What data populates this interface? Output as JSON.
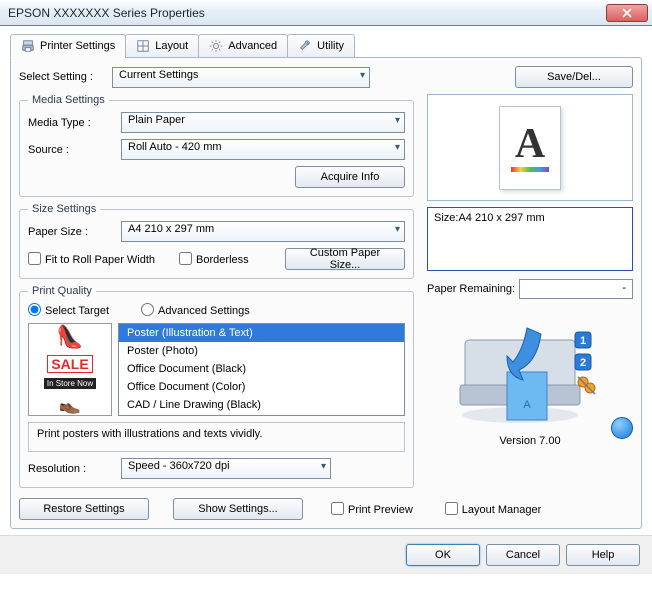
{
  "window": {
    "title": "EPSON XXXXXXX Series Properties"
  },
  "tabs": {
    "printer_settings": "Printer Settings",
    "layout": "Layout",
    "advanced": "Advanced",
    "utility": "Utility"
  },
  "select_setting": {
    "label": "Select Setting :",
    "value": "Current Settings",
    "save_del": "Save/Del..."
  },
  "media_settings": {
    "legend": "Media Settings",
    "media_type_label": "Media Type :",
    "media_type_value": "Plain Paper",
    "source_label": "Source :",
    "source_value": "Roll Auto - 420 mm",
    "acquire_info": "Acquire Info"
  },
  "size_settings": {
    "legend": "Size Settings",
    "paper_size_label": "Paper Size :",
    "paper_size_value": "A4 210 x 297 mm",
    "fit_roll": "Fit to Roll Paper Width",
    "borderless": "Borderless",
    "custom_size": "Custom Paper Size..."
  },
  "print_quality": {
    "legend": "Print Quality",
    "select_target": "Select Target",
    "advanced_settings": "Advanced Settings",
    "targets": [
      "Poster (Illustration & Text)",
      "Poster (Photo)",
      "Office Document (Black)",
      "Office Document (Color)",
      "CAD / Line Drawing (Black)"
    ],
    "selected_index": 0,
    "description": "Print posters with illustrations and texts vividly.",
    "resolution_label": "Resolution :",
    "resolution_value": "Speed - 360x720 dpi",
    "poster_sale": "SALE",
    "poster_instore": "In Store Now"
  },
  "preview": {
    "size_line": "Size:A4 210 x 297 mm",
    "paper_remaining_label": "Paper Remaining:",
    "paper_remaining_value": "-",
    "version": "Version 7.00"
  },
  "bottom": {
    "restore": "Restore Settings",
    "show": "Show Settings...",
    "print_preview": "Print Preview",
    "layout_manager": "Layout Manager"
  },
  "dialog": {
    "ok": "OK",
    "cancel": "Cancel",
    "help": "Help"
  }
}
